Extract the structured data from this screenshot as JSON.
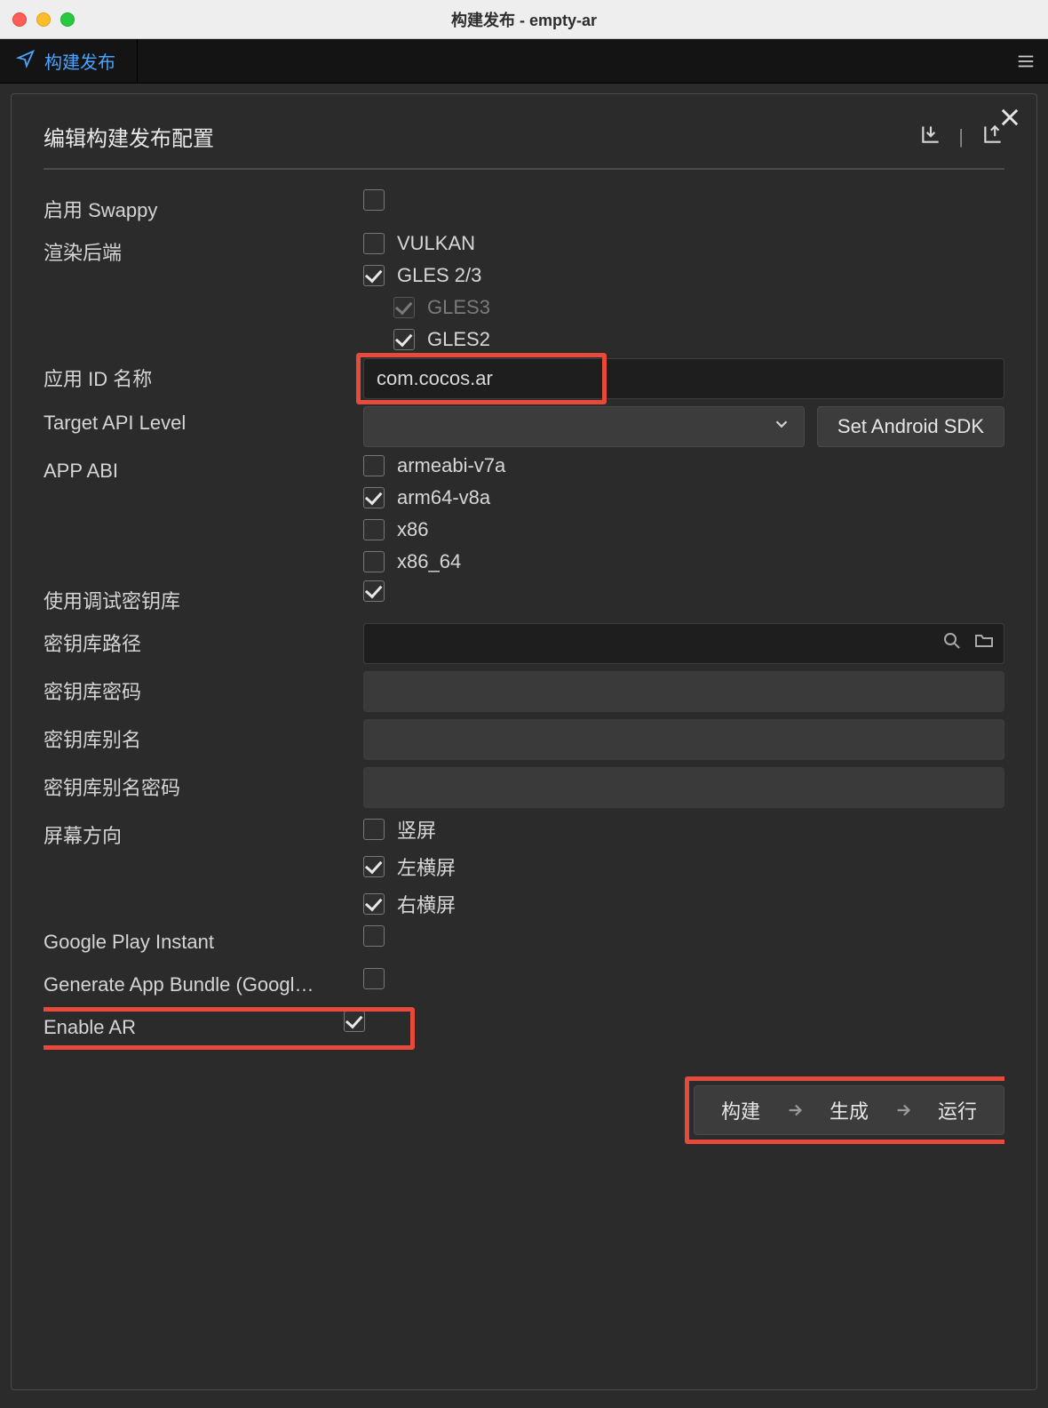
{
  "window": {
    "title": "构建发布 - empty-ar"
  },
  "tab": {
    "label": "构建发布"
  },
  "panel": {
    "title": "编辑构建发布配置"
  },
  "swappy": {
    "label": "启用 Swappy",
    "checked": false
  },
  "render_backend": {
    "label": "渲染后端",
    "vulkan": {
      "label": "VULKAN",
      "checked": false
    },
    "gles23": {
      "label": "GLES 2/3",
      "checked": true
    },
    "gles3": {
      "label": "GLES3",
      "checked": true,
      "disabled": true
    },
    "gles2": {
      "label": "GLES2",
      "checked": true
    }
  },
  "app_id": {
    "label": "应用 ID 名称",
    "value": "com.cocos.ar"
  },
  "api_level": {
    "label": "Target API Level",
    "button": "Set Android SDK"
  },
  "abi": {
    "label": "APP ABI",
    "armeabi_v7a": {
      "label": "armeabi-v7a",
      "checked": false
    },
    "arm64_v8a": {
      "label": "arm64-v8a",
      "checked": true
    },
    "x86": {
      "label": "x86",
      "checked": false
    },
    "x86_64": {
      "label": "x86_64",
      "checked": false
    }
  },
  "debug_keystore": {
    "label": "使用调试密钥库",
    "checked": true
  },
  "keystore_path": {
    "label": "密钥库路径"
  },
  "keystore_pass": {
    "label": "密钥库密码"
  },
  "keystore_alias": {
    "label": "密钥库别名"
  },
  "keystore_alias_pass": {
    "label": "密钥库别名密码"
  },
  "orientation": {
    "label": "屏幕方向",
    "portrait": {
      "label": "竖屏",
      "checked": false
    },
    "land_left": {
      "label": "左横屏",
      "checked": true
    },
    "land_right": {
      "label": "右横屏",
      "checked": true
    }
  },
  "gp_instant": {
    "label": "Google Play Instant",
    "checked": false
  },
  "app_bundle": {
    "label": "Generate App Bundle (Googl…",
    "checked": false
  },
  "enable_ar": {
    "label": "Enable AR",
    "checked": true
  },
  "footer": {
    "build": "构建",
    "make": "生成",
    "run": "运行"
  }
}
